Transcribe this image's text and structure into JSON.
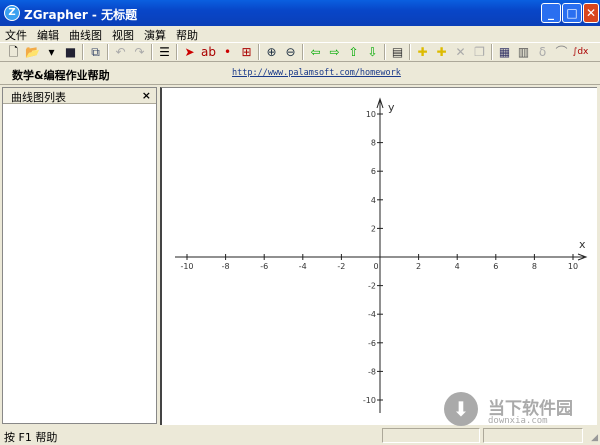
{
  "window": {
    "title": "ZGrapher - 无标题",
    "logo": "Z"
  },
  "menu": [
    "文件",
    "编辑",
    "曲线图",
    "视图",
    "演算",
    "帮助"
  ],
  "toolbar": [
    {
      "icon": "new-icon",
      "glyph": "🗋",
      "color": "#000"
    },
    {
      "icon": "open-icon",
      "glyph": "📂",
      "color": "#c90"
    },
    {
      "icon": "dropdown-icon",
      "glyph": "▾",
      "color": "#000"
    },
    {
      "icon": "save-icon",
      "glyph": "■",
      "color": "#223"
    },
    {
      "sep": true
    },
    {
      "icon": "copy-icon",
      "glyph": "⧉",
      "color": "#346"
    },
    {
      "sep": true
    },
    {
      "icon": "undo-icon",
      "glyph": "↶",
      "color": "#aaa"
    },
    {
      "icon": "redo-icon",
      "glyph": "↷",
      "color": "#aaa"
    },
    {
      "sep": true
    },
    {
      "icon": "list-icon",
      "glyph": "☰",
      "color": "#000"
    },
    {
      "sep": true
    },
    {
      "icon": "pointer-icon",
      "glyph": "➤",
      "color": "#c00"
    },
    {
      "icon": "text-label-icon",
      "glyph": "ab",
      "color": "#a00"
    },
    {
      "icon": "point-icon",
      "glyph": "•",
      "color": "#c00"
    },
    {
      "icon": "zoom-box-icon",
      "glyph": "⊞",
      "color": "#a00"
    },
    {
      "sep": true
    },
    {
      "icon": "zoom-in-icon",
      "glyph": "⊕",
      "color": "#234"
    },
    {
      "icon": "zoom-out-icon",
      "glyph": "⊖",
      "color": "#234"
    },
    {
      "sep": true
    },
    {
      "icon": "arrow-left-icon",
      "glyph": "⇦",
      "color": "#0a0"
    },
    {
      "icon": "arrow-right-icon",
      "glyph": "⇨",
      "color": "#0a0"
    },
    {
      "icon": "arrow-up-icon",
      "glyph": "⇧",
      "color": "#0a0"
    },
    {
      "icon": "arrow-down-icon",
      "glyph": "⇩",
      "color": "#0a0"
    },
    {
      "sep": true
    },
    {
      "icon": "properties-icon",
      "glyph": "▤",
      "color": "#333"
    },
    {
      "sep": true
    },
    {
      "icon": "add-graph-icon",
      "glyph": "✚",
      "color": "#db0"
    },
    {
      "icon": "add-table-graph-icon",
      "glyph": "✚",
      "color": "#db0"
    },
    {
      "icon": "delete-icon",
      "glyph": "✕",
      "color": "#aaa"
    },
    {
      "icon": "duplicate-icon",
      "glyph": "❐",
      "color": "#aaa"
    },
    {
      "sep": true
    },
    {
      "icon": "table-icon",
      "glyph": "▦",
      "color": "#336"
    },
    {
      "icon": "calculator-icon",
      "glyph": "▥",
      "color": "#555"
    },
    {
      "icon": "derivative-icon",
      "glyph": "ẟ",
      "color": "#aaa"
    },
    {
      "icon": "tangent-icon",
      "glyph": "⌒",
      "color": "#888"
    },
    {
      "icon": "integral-icon",
      "glyph": "∫dx",
      "color": "#a00"
    }
  ],
  "helpbar": {
    "title": "数学&编程作业帮助",
    "link": "http://www.palamsoft.com/homework"
  },
  "panel": {
    "title": "曲线图列表",
    "close": "×"
  },
  "status": {
    "text": "按 F1 帮助"
  },
  "watermark": {
    "name": "当下软件园",
    "domain": "downxia.com"
  },
  "chart_data": {
    "type": "line",
    "xlabel": "x",
    "ylabel": "y",
    "xlim": [
      -10,
      10
    ],
    "ylim": [
      -10,
      10
    ],
    "xticks": [
      -10,
      -8,
      -6,
      -4,
      -2,
      0,
      2,
      4,
      6,
      8,
      10
    ],
    "yticks": [
      10,
      8,
      6,
      4,
      2,
      -2,
      -4,
      -6,
      -8,
      -10
    ],
    "series": [],
    "grid": false
  }
}
